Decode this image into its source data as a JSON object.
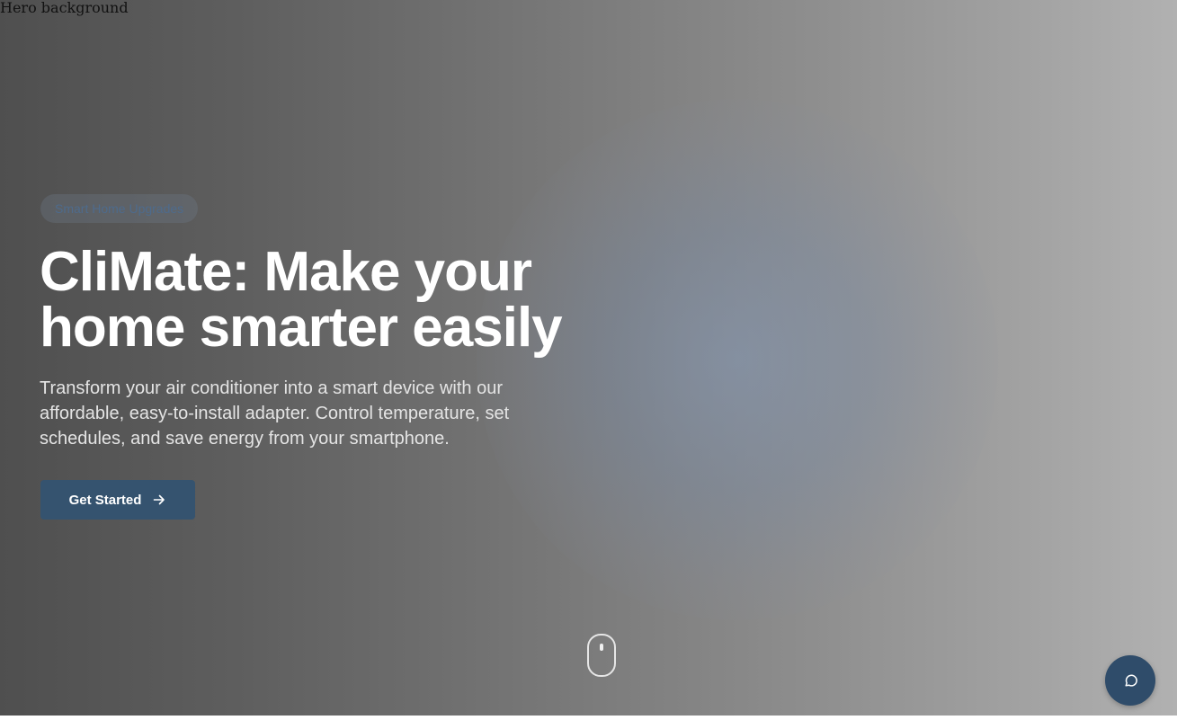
{
  "hero": {
    "background_alt": "Hero background",
    "badge": "Smart Home Upgrades",
    "title": "CliMate: Make your home smarter easily",
    "subtitle": "Transform your air conditioner into a smart device with our affordable, easy-to-install adapter. Control temperature, set schedules, and save energy from your smartphone.",
    "cta_label": "Get Started",
    "cta_icon": "arrow-right-icon",
    "scroll_icon": "mouse-scroll-icon"
  },
  "chat": {
    "icon": "chat-bubble-icon"
  },
  "colors": {
    "accent": "#35536f",
    "chat_button": "#2f4c6a",
    "badge_text": "#4e6b8c"
  }
}
